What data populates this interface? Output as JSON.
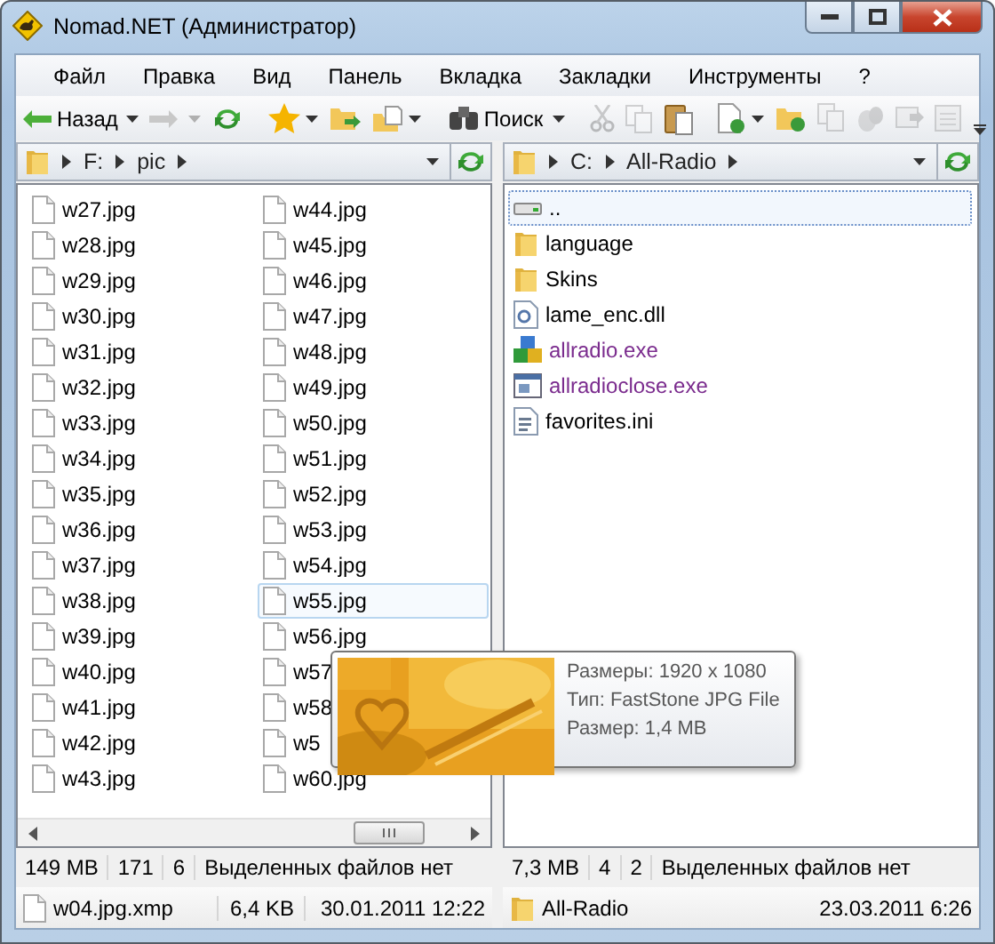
{
  "window": {
    "title": "Nomad.NET (Администратор)"
  },
  "menu": [
    "Файл",
    "Правка",
    "Вид",
    "Панель",
    "Вкладка",
    "Закладки",
    "Инструменты",
    "?"
  ],
  "toolbar": {
    "back_label": "Назад",
    "forward_disabled": true,
    "search_label": "Поиск",
    "cut_copy_disabled": true,
    "file_actions_disabled": true
  },
  "panels": [
    {
      "path": [
        "F:",
        "pic"
      ],
      "columns": [
        [
          {
            "name": "w27.jpg",
            "selected": false
          },
          {
            "name": "w28.jpg",
            "selected": false
          },
          {
            "name": "w29.jpg",
            "selected": false
          },
          {
            "name": "w30.jpg",
            "selected": false
          },
          {
            "name": "w31.jpg",
            "selected": false
          },
          {
            "name": "w32.jpg",
            "selected": false
          },
          {
            "name": "w33.jpg",
            "selected": false
          },
          {
            "name": "w34.jpg",
            "selected": false
          },
          {
            "name": "w35.jpg",
            "selected": false
          },
          {
            "name": "w36.jpg",
            "selected": false
          },
          {
            "name": "w37.jpg",
            "selected": false
          },
          {
            "name": "w38.jpg",
            "selected": false
          },
          {
            "name": "w39.jpg",
            "selected": false
          },
          {
            "name": "w40.jpg",
            "selected": false
          },
          {
            "name": "w41.jpg",
            "selected": false
          },
          {
            "name": "w42.jpg",
            "selected": false
          },
          {
            "name": "w43.jpg",
            "selected": false
          }
        ],
        [
          {
            "name": "w44.jpg",
            "selected": false
          },
          {
            "name": "w45.jpg",
            "selected": false
          },
          {
            "name": "w46.jpg",
            "selected": false
          },
          {
            "name": "w47.jpg",
            "selected": false
          },
          {
            "name": "w48.jpg",
            "selected": false
          },
          {
            "name": "w49.jpg",
            "selected": false
          },
          {
            "name": "w50.jpg",
            "selected": false
          },
          {
            "name": "w51.jpg",
            "selected": false
          },
          {
            "name": "w52.jpg",
            "selected": false
          },
          {
            "name": "w53.jpg",
            "selected": false
          },
          {
            "name": "w54.jpg",
            "selected": false
          },
          {
            "name": "w55.jpg",
            "selected": true
          },
          {
            "name": "w56.jpg",
            "selected": false
          },
          {
            "name": "w57",
            "selected": false
          },
          {
            "name": "w58",
            "selected": false
          },
          {
            "name": "w5",
            "selected": false
          },
          {
            "name": "w60.jpg",
            "selected": false
          }
        ]
      ],
      "status": [
        "149 MB",
        "171",
        "6",
        "Выделенных файлов нет"
      ],
      "info": {
        "kind": "file",
        "name": "w04.jpg.xmp",
        "size": "6,4 KB",
        "date": "30.01.2011 12:22"
      }
    },
    {
      "path": [
        "C:",
        "All-Radio"
      ],
      "items": [
        {
          "kind": "up",
          "name": "..",
          "selected": true,
          "color": "#000000"
        },
        {
          "kind": "folder",
          "name": "language",
          "selected": false,
          "color": "#000000"
        },
        {
          "kind": "folder",
          "name": "Skins",
          "selected": false,
          "color": "#000000"
        },
        {
          "kind": "dll",
          "name": "lame_enc.dll",
          "selected": false,
          "color": "#000000"
        },
        {
          "kind": "app",
          "name": "allradio.exe",
          "selected": false,
          "color": "#7b2c8e"
        },
        {
          "kind": "window",
          "name": "allradioclose.exe",
          "selected": false,
          "color": "#7b2c8e"
        },
        {
          "kind": "settings",
          "name": "favorites.ini",
          "selected": false,
          "color": "#000000"
        }
      ],
      "status": [
        "7,3 MB",
        "4",
        "2",
        "Выделенных файлов нет"
      ],
      "info": {
        "kind": "folder",
        "name": "All-Radio",
        "date": "23.03.2011 6:26"
      }
    }
  ],
  "tooltip": {
    "kind": "picture",
    "lines": [
      "Размеры: 1920 x 1080",
      "Тип: FastStone JPG File",
      "Размер: 1,4 MB"
    ]
  }
}
